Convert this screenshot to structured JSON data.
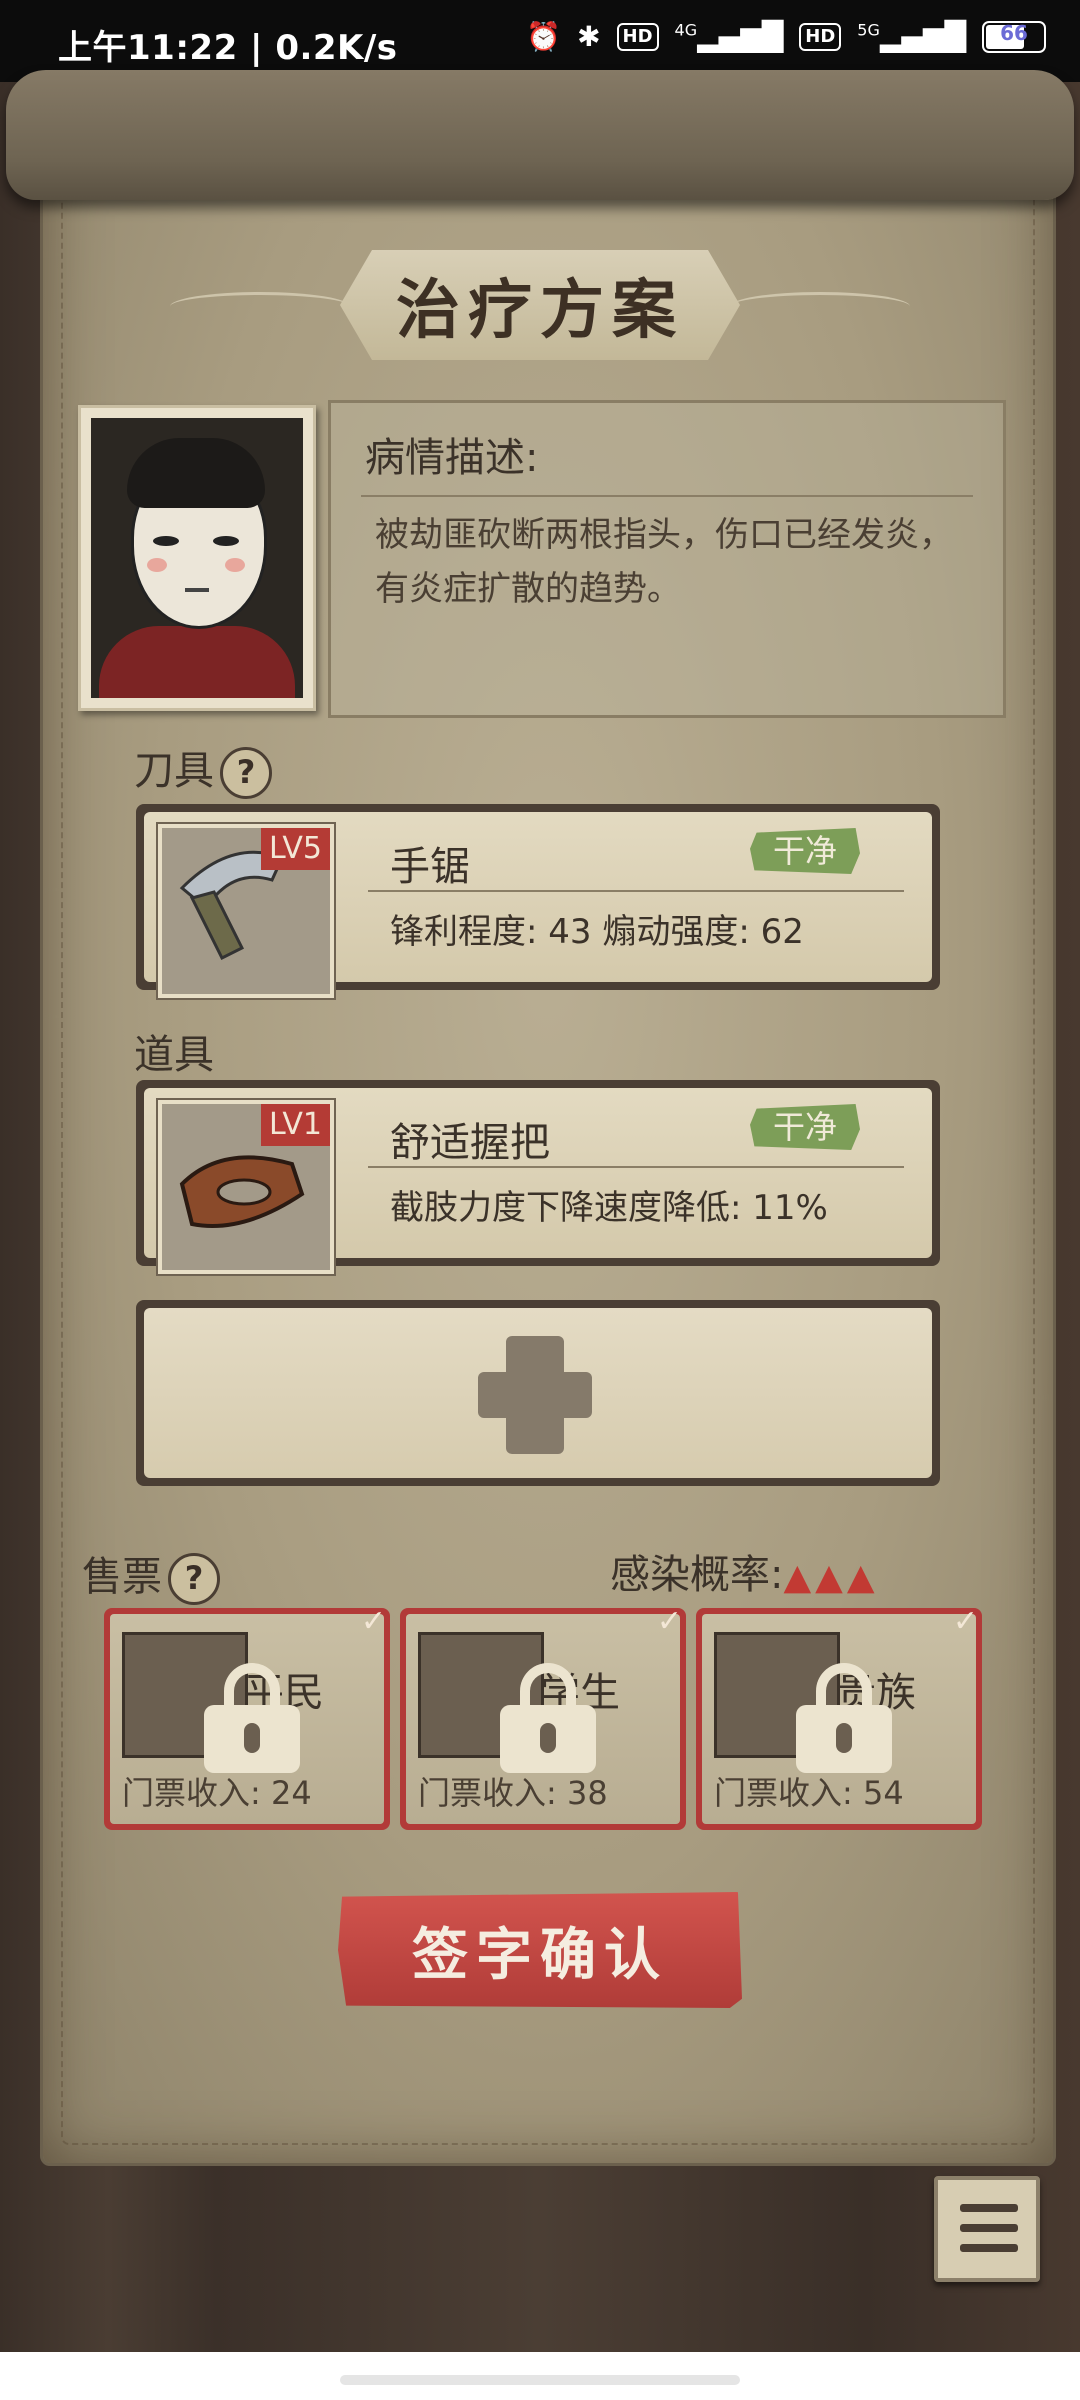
{
  "status_bar": {
    "time": "上午11:22 | 0.2K/s",
    "icons": [
      "alarm-icon",
      "app-icon",
      "app-icon",
      "bluetooth-icon",
      "hd-icon",
      "4g-signal-icon",
      "hd-icon",
      "5g-signal-icon",
      "battery-icon"
    ],
    "hd_label": "HD",
    "net_4g": "4G",
    "net_5g": "5G",
    "battery": "66"
  },
  "title": "治疗方案",
  "patient": {
    "description_label": "病情描述:",
    "description": "被劫匪砍断两根指头，伤口已经发炎，有炎症扩散的趋势。"
  },
  "blade_section": {
    "label": "刀具",
    "help_icon": "?",
    "item": {
      "level": "LV5",
      "name": "手锯",
      "tag": "干净",
      "stats": "锋利程度: 43   煽动强度: 62"
    }
  },
  "tool_section": {
    "label": "道具",
    "item": {
      "level": "LV1",
      "name": "舒适握把",
      "tag": "干净",
      "stats": "截肢力度下降速度降低: 11%"
    },
    "add_slot_icon": "plus-icon"
  },
  "ticket_section": {
    "label": "售票",
    "help_icon": "?",
    "infection_label": "感染概率:",
    "infection_level": "▲▲▲",
    "check": "✓",
    "tickets": [
      {
        "name": "平民",
        "income": "门票收入: 24"
      },
      {
        "name": "学生",
        "income": "门票收入: 38"
      },
      {
        "name": "贵族",
        "income": "门票收入: 54"
      }
    ]
  },
  "confirm_button": "签字确认",
  "colors": {
    "parchment": "#b9ae93",
    "accent_red": "#b23a38",
    "clean_tag": "#7d9e58"
  }
}
